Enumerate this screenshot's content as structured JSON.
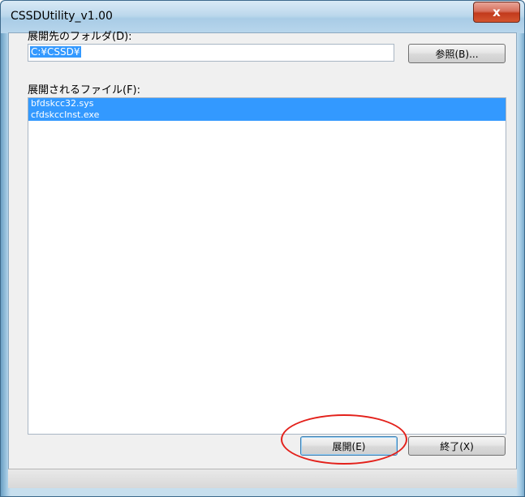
{
  "window": {
    "title": "CSSDUtility_v1.00",
    "close_glyph": "x"
  },
  "folder": {
    "label": "展開先のフォルダ(D):",
    "value": "C:¥CSSD¥",
    "browse_label": "参照(B)..."
  },
  "files": {
    "label": "展開されるファイル(F):",
    "items": [
      "bfdskcc32.sys",
      "cfdskccInst.exe"
    ]
  },
  "buttons": {
    "extract_label": "展開(E)",
    "exit_label": "終了(X)"
  },
  "colors": {
    "selection": "#3399ff",
    "highlight_ring": "#e3211b"
  }
}
